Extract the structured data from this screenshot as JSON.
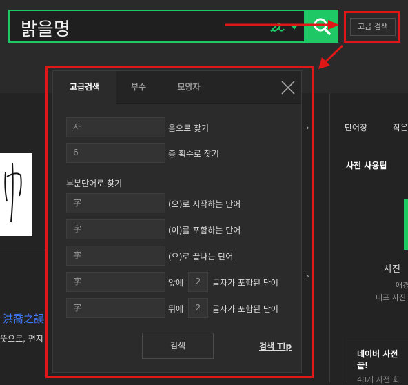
{
  "search": {
    "query": "밝을명"
  },
  "header": {
    "advanced_button": "고급 검색"
  },
  "background": {
    "right_tabs": [
      "단어장",
      "작은"
    ],
    "usage_tip_title": "사전 사용팁",
    "right_caption": "사진",
    "right_sub1": "애경",
    "right_sub2": "대표 사진",
    "right_box_title": "네이버 사전",
    "right_box_title2": "끝!",
    "right_box_sub": "48개 사전 회",
    "left_link": "洪喬之誤",
    "left_text": "뜻으로, 편지"
  },
  "popup": {
    "tabs": [
      "고급검색",
      "부수",
      "모양자"
    ],
    "rows": [
      {
        "value": "자",
        "suffix": "음으로 찾기"
      },
      {
        "value": "6",
        "suffix": "총 획수로 찾기"
      }
    ],
    "partial_title": "부분단어로 찾기",
    "partial_rows": [
      {
        "value": "字",
        "suffix": "(으)로 시작하는 단어"
      },
      {
        "value": "字",
        "suffix": "(이)를 포함하는 단어"
      },
      {
        "value": "字",
        "suffix": "(으)로 끝나는 단어"
      }
    ],
    "pos_rows": [
      {
        "value": "字",
        "before": "앞에",
        "count": "2",
        "after": "글자가 포함된 단어"
      },
      {
        "value": "字",
        "before": "뒤에",
        "count": "2",
        "after": "글자가 포함된 단어"
      }
    ],
    "search_button": "검색",
    "tip_link": "검색 Tip"
  },
  "colors": {
    "accent": "#1ec864",
    "highlight": "#e01717",
    "link": "#3d7bff"
  }
}
